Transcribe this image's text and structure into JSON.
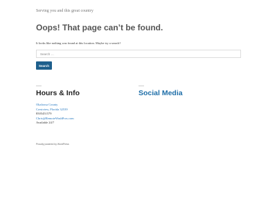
{
  "site": {
    "tagline": "Serving you and this great country"
  },
  "main": {
    "title": "Oops! That page can’t be found.",
    "notice": "It looks like nothing was found at this location. Maybe try a search?",
    "search": {
      "placeholder": "Search …",
      "value": "",
      "button_label": "Search"
    }
  },
  "widgets": {
    "hours": {
      "title": "Hours & Info",
      "address_line1": "Okaloosa County",
      "address_line2": "Crestview, Florida 32539",
      "phone": "8505451579",
      "email": "Chris@RemoteWashPros.com",
      "availability": "Available 24/7"
    },
    "social": {
      "title": "Social Media"
    }
  },
  "footer": {
    "credit": "Proudly powered by WordPress"
  },
  "colors": {
    "accent": "#1e5f8c",
    "link": "#1e73be",
    "title_gray": "#555555"
  }
}
